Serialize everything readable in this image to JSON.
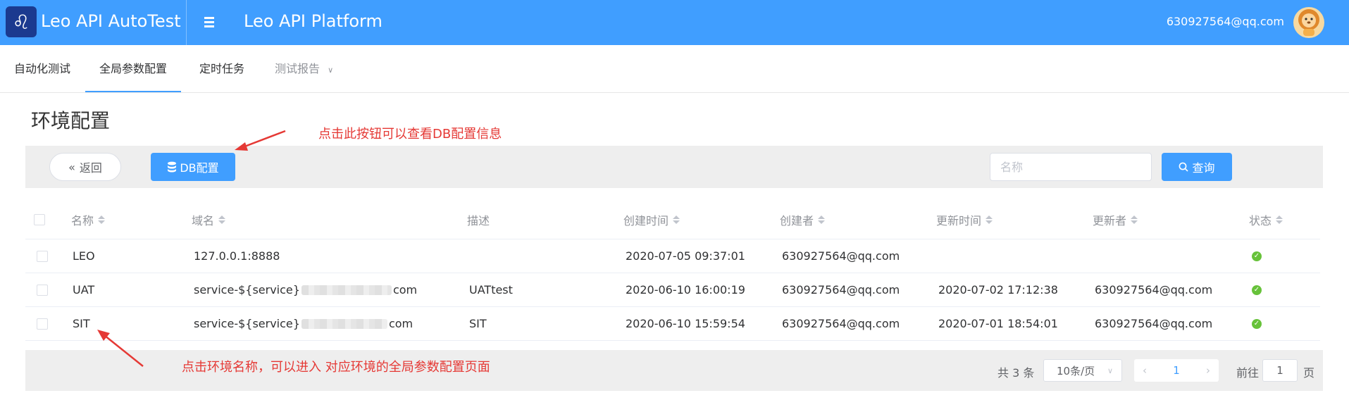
{
  "header": {
    "app_title": "Leo API AutoTest",
    "platform_title": "Leo API Platform",
    "user_email": "630927564@qq.com",
    "brand_color": "#409eff"
  },
  "tabs": [
    {
      "label": "自动化测试",
      "active": false
    },
    {
      "label": "全局参数配置",
      "active": true
    },
    {
      "label": "定时任务",
      "active": false
    },
    {
      "label": "测试报告",
      "active": false,
      "has_dropdown": true
    }
  ],
  "page_title": "环境配置",
  "toolbar": {
    "back_label": "返回",
    "db_label": "DB配置",
    "search_placeholder": "名称",
    "search_label": "查询"
  },
  "table": {
    "columns": [
      "名称",
      "域名",
      "描述",
      "创建时间",
      "创建者",
      "更新时间",
      "更新者",
      "状态"
    ],
    "rows": [
      {
        "name": "LEO",
        "domain_prefix": "127.0.0.1:8888",
        "domain_suffix": "",
        "desc": "",
        "created": "2020-07-05 09:37:01",
        "creator": "630927564@qq.com",
        "updated": "",
        "updater": "",
        "status": "enabled"
      },
      {
        "name": "UAT",
        "domain_prefix": "service-${service}",
        "domain_suffix": "com",
        "desc": "UATtest",
        "created": "2020-06-10 16:00:19",
        "creator": "630927564@qq.com",
        "updated": "2020-07-02 17:12:38",
        "updater": "630927564@qq.com",
        "status": "enabled"
      },
      {
        "name": "SIT",
        "domain_prefix": "service-${service}",
        "domain_suffix": "com",
        "desc": "SIT",
        "created": "2020-06-10 15:59:54",
        "creator": "630927564@qq.com",
        "updated": "2020-07-01 18:54:01",
        "updater": "630927564@qq.com",
        "status": "enabled"
      }
    ]
  },
  "pagination": {
    "total": "共 3 条",
    "page_size": "10条/页",
    "current_page": "1",
    "goto_label": "前往",
    "goto_value": "1",
    "page_label": "页"
  },
  "annotations": {
    "db_hint": "点击此按钮可以查看DB配置信息",
    "name_hint": "点击环境名称，可以进入 对应环境的全局参数配置页面"
  }
}
